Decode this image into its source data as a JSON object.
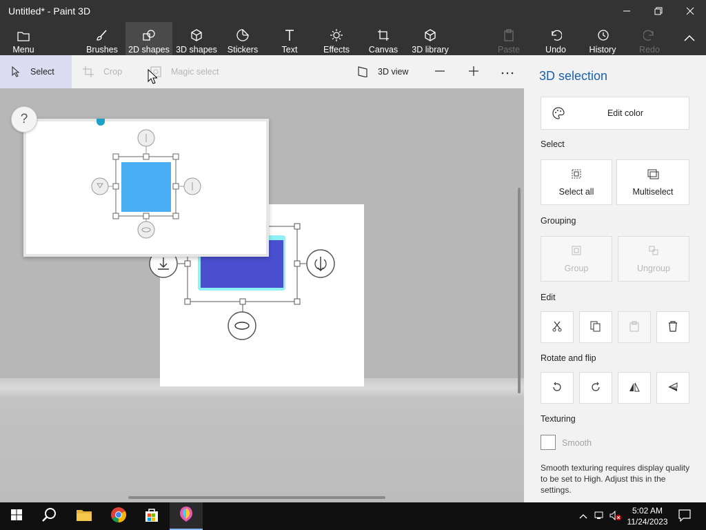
{
  "window": {
    "title": "Untitled* - Paint 3D"
  },
  "ribbon": {
    "menu": "Menu",
    "brushes": "Brushes",
    "shapes2d": "2D shapes",
    "shapes3d": "3D shapes",
    "stickers": "Stickers",
    "text": "Text",
    "effects": "Effects",
    "canvas": "Canvas",
    "library3d": "3D library",
    "paste": "Paste",
    "undo": "Undo",
    "history": "History",
    "redo": "Redo"
  },
  "toolbar": {
    "select": "Select",
    "crop": "Crop",
    "magic_select": "Magic select",
    "view3d": "3D view"
  },
  "panel": {
    "title": "3D selection",
    "edit_color": "Edit color",
    "select_section": "Select",
    "select_all": "Select all",
    "multiselect": "Multiselect",
    "grouping_section": "Grouping",
    "group": "Group",
    "ungroup": "Ungroup",
    "edit_section": "Edit",
    "rotate_section": "Rotate and flip",
    "texturing_section": "Texturing",
    "smooth": "Smooth",
    "smooth_note": "Smooth texturing requires display quality to be set to High. Adjust this in the settings."
  },
  "help": {
    "label": "?"
  },
  "taskbar": {
    "time": "5:02 AM",
    "date": "11/24/2023"
  },
  "colors": {
    "shape_main": "#4a4fcf",
    "shape_glow": "#8ff0f5",
    "shape_preview": "#4aaef5",
    "accent": "#1a5fa8"
  },
  "icons": [
    "folder-icon",
    "brush-icon",
    "shapes2d-icon",
    "cube-icon",
    "sticker-icon",
    "text-icon",
    "effects-icon",
    "canvas-icon",
    "library-icon",
    "paste-icon",
    "undo-icon",
    "history-icon",
    "redo-icon"
  ]
}
